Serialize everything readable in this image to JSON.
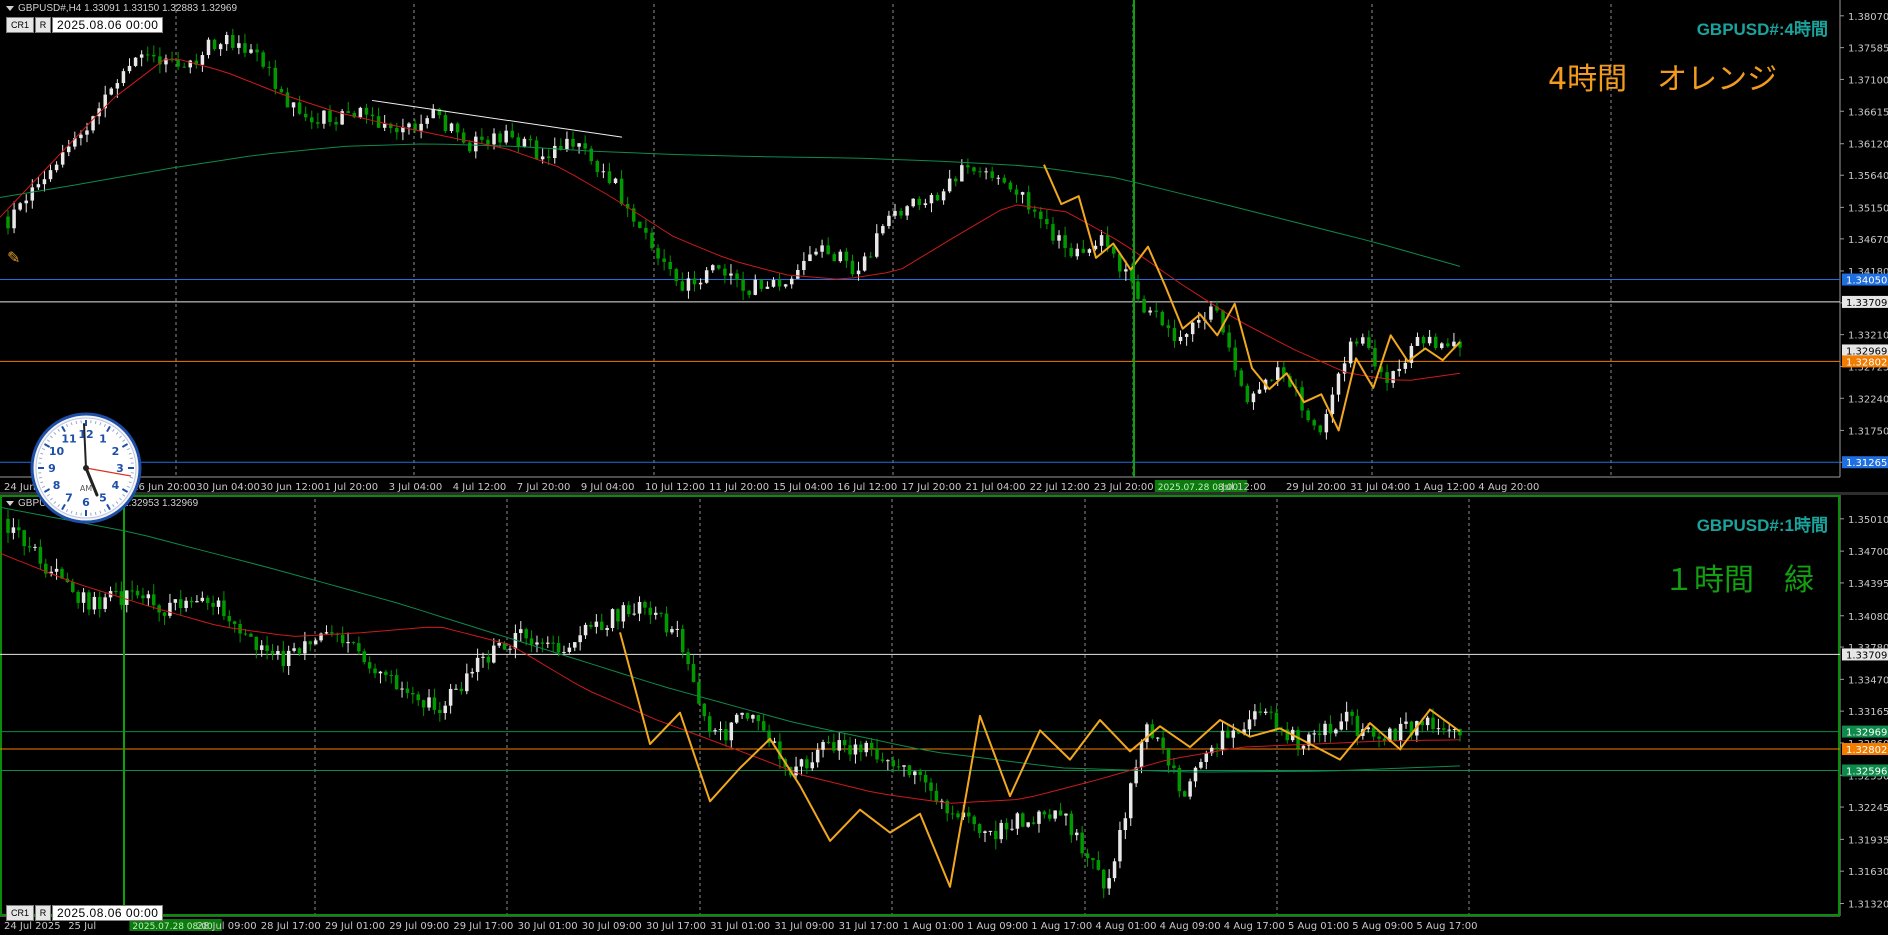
{
  "colors": {
    "bg": "#000000",
    "grid": "#8c8c8c",
    "bull": "#e8e8e8",
    "bear": "#009900",
    "ma_red": "#cc1a1a",
    "ma_green": "#0e8a4a",
    "zigzag": "#f2a81e",
    "blue_line": "#1f6fe0",
    "white_line": "#e6e6e6",
    "orange_line": "#f27c00",
    "green_vline": "#0aa30a",
    "axis_text": "#c8c8c8",
    "label_teal": "#1aa39c",
    "note_orange": "#f29b1e",
    "note_green": "#12a012"
  },
  "pane1": {
    "header_text": "GBPUSD#,H4  1.33091 1.33150 1.32883 1.32969",
    "chips": [
      "CR1",
      "R"
    ],
    "date_box": "2025.08.06 00:00",
    "symbol_label": "GBPUSD#:4時間",
    "note": "4時間　オレンジ",
    "xaxis_labels": [
      "24 Jun",
      "25 Jun 12:00",
      "26 Jun 20:00",
      "30 Jun 04:00",
      "30 Jun 12:00",
      "1 Jul 20:00",
      "3 Jul 04:00",
      "4 Jul 12:00",
      "7 Jul 20:00",
      "9 Jul 04:00",
      "10 Jul 12:00",
      "11 Jul 20:00",
      "15 Jul 04:00",
      "16 Jul 12:00",
      "17 Jul 20:00",
      "21 Jul 04:00",
      "22 Jul 12:00",
      "23 Jul 20:00",
      "2025.07.28 08:00",
      "Jul 12:00",
      "29 Jul 20:00",
      "31 Jul 04:00",
      "1 Aug 12:00",
      "4 Aug 20:00"
    ],
    "price_ticks": [
      "1.38070",
      "1.37585",
      "1.37100",
      "1.36615",
      "1.36120",
      "1.35640",
      "1.35150",
      "1.34670",
      "1.34180",
      "1.33695",
      "1.33210",
      "1.32725",
      "1.32240",
      "1.31750",
      "1.31265"
    ],
    "price_tags": [
      {
        "text": "1.34050",
        "price": 1.3405,
        "color": "#1f6fe0"
      },
      {
        "text": "1.33709",
        "price": 1.33709,
        "color": "#e6e6e6"
      },
      {
        "text": "1.32969",
        "price": 1.32969,
        "color": "#e6e6e6"
      },
      {
        "text": "1.32802",
        "price": 1.32802,
        "color": "#f27c00"
      },
      {
        "text": "1.31265",
        "price": 1.31265,
        "color": "#1f6fe0"
      }
    ]
  },
  "pane2": {
    "header_text": "GBPUSD#,H1  1.32972 1.32953 1.32969",
    "chips": [
      "CR1",
      "R"
    ],
    "date_box": "2025.08.06 00:00",
    "symbol_label": "GBPUSD#:1時間",
    "note": "１時間　緑",
    "xaxis_labels": [
      "24 Jul 2025",
      "25 Jul",
      "2025.07.28 08:00",
      "28 Jul 09:00",
      "28 Jul 17:00",
      "29 Jul 01:00",
      "29 Jul 09:00",
      "29 Jul 17:00",
      "30 Jul 01:00",
      "30 Jul 09:00",
      "30 Jul 17:00",
      "31 Jul 01:00",
      "31 Jul 09:00",
      "31 Jul 17:00",
      "1 Aug 01:00",
      "1 Aug 09:00",
      "1 Aug 17:00",
      "4 Aug 01:00",
      "4 Aug 09:00",
      "4 Aug 17:00",
      "5 Aug 01:00",
      "5 Aug 09:00",
      "5 Aug 17:00"
    ],
    "price_ticks": [
      "1.35010",
      "1.34700",
      "1.34395",
      "1.34080",
      "1.33780",
      "1.33470",
      "1.33165",
      "1.32860",
      "1.32550",
      "1.32245",
      "1.31935",
      "1.31630",
      "1.31320"
    ],
    "price_tags": [
      {
        "text": "1.33709",
        "price": 1.33709,
        "color": "#e6e6e6"
      },
      {
        "text": "1.32969",
        "price": 1.32969,
        "color": "#0e8a4a"
      },
      {
        "text": "1.32802",
        "price": 1.32802,
        "color": "#f27c00"
      },
      {
        "text": "1.32596",
        "price": 1.32596,
        "color": "#0e8a4a"
      }
    ]
  },
  "chart_data": [
    {
      "type": "candlestick",
      "symbol": "GBPUSD#",
      "timeframe": "H4",
      "ylim": [
        1.3104,
        1.3825
      ],
      "hlines": [
        {
          "price": 1.3405,
          "color": "#1f6fe0"
        },
        {
          "price": 1.33709,
          "color": "#e6e6e6"
        },
        {
          "price": 1.32802,
          "color": "#f27c00"
        },
        {
          "price": 1.31265,
          "color": "#1f6fe0"
        }
      ],
      "close_path": [
        1.3495,
        1.3562,
        1.3625,
        1.37,
        1.3752,
        1.373,
        1.3775,
        1.3748,
        1.3665,
        1.365,
        1.366,
        1.363,
        1.3655,
        1.361,
        1.3625,
        1.3598,
        1.3615,
        1.356,
        1.347,
        1.3395,
        1.342,
        1.3392,
        1.34,
        1.345,
        1.342,
        1.3505,
        1.3525,
        1.3575,
        1.3565,
        1.3505,
        1.344,
        1.3465,
        1.337,
        1.332,
        1.3365,
        1.3225,
        1.3265,
        1.3175,
        1.3325,
        1.3255,
        1.332,
        1.3297
      ],
      "ma_fast": [
        1.35,
        1.359,
        1.368,
        1.3745,
        1.3722,
        1.3688,
        1.366,
        1.364,
        1.3622,
        1.3605,
        1.3575,
        1.3525,
        1.347,
        1.3435,
        1.3412,
        1.3405,
        1.3418,
        1.347,
        1.352,
        1.3508,
        1.346,
        1.34,
        1.3345,
        1.33,
        1.3262,
        1.325,
        1.3262
      ],
      "ma_slow": [
        1.353,
        1.3552,
        1.3575,
        1.3595,
        1.3608,
        1.3612,
        1.3608,
        1.36,
        1.3595,
        1.3592,
        1.359,
        1.3585,
        1.3578,
        1.356,
        1.3528,
        1.3495,
        1.3462,
        1.3425
      ],
      "zigzag": [
        1.358,
        1.352,
        1.3532,
        1.3438,
        1.346,
        1.342,
        1.3455,
        1.3395,
        1.333,
        1.3352,
        1.332,
        1.3368,
        1.327,
        1.3238,
        1.3262,
        1.3218,
        1.323,
        1.3175,
        1.3285,
        1.324,
        1.332,
        1.328,
        1.33,
        1.3282,
        1.331
      ]
    },
    {
      "type": "candlestick",
      "symbol": "GBPUSD#",
      "timeframe": "H1",
      "ylim": [
        1.312,
        1.352
      ],
      "hlines": [
        {
          "price": 1.33709,
          "color": "#e6e6e6"
        },
        {
          "price": 1.32969,
          "color": "#0e8a4a"
        },
        {
          "price": 1.32802,
          "color": "#f27c00"
        },
        {
          "price": 1.32596,
          "color": "#0e8a4a"
        }
      ],
      "close_path": [
        1.3495,
        1.3455,
        1.342,
        1.3428,
        1.3415,
        1.343,
        1.339,
        1.3365,
        1.3395,
        1.3372,
        1.334,
        1.3318,
        1.3362,
        1.339,
        1.3378,
        1.34,
        1.3418,
        1.3395,
        1.329,
        1.3315,
        1.3258,
        1.3285,
        1.3278,
        1.3262,
        1.322,
        1.3198,
        1.3215,
        1.3212,
        1.3148,
        1.3305,
        1.3238,
        1.3298,
        1.3312,
        1.3285,
        1.331,
        1.3288,
        1.3305,
        1.3297
      ],
      "ma_fast": [
        1.3468,
        1.344,
        1.3418,
        1.3398,
        1.3388,
        1.3392,
        1.3398,
        1.338,
        1.3338,
        1.3308,
        1.3282,
        1.3255,
        1.3238,
        1.3228,
        1.3232,
        1.325,
        1.327,
        1.3282,
        1.3285,
        1.3288,
        1.3289
      ],
      "ma_slow": [
        1.3512,
        1.3488,
        1.3455,
        1.342,
        1.338,
        1.334,
        1.3305,
        1.3278,
        1.3262,
        1.3258,
        1.3259,
        1.3264
      ],
      "zigzag": [
        1.3392,
        1.3285,
        1.3315,
        1.323,
        1.3262,
        1.329,
        1.3245,
        1.3192,
        1.3222,
        1.32,
        1.3218,
        1.3148,
        1.3312,
        1.3235,
        1.3298,
        1.327,
        1.3308,
        1.3278,
        1.3302,
        1.3282,
        1.3308,
        1.3292,
        1.33,
        1.3285,
        1.327,
        1.3305,
        1.328,
        1.3318,
        1.3297
      ]
    }
  ]
}
